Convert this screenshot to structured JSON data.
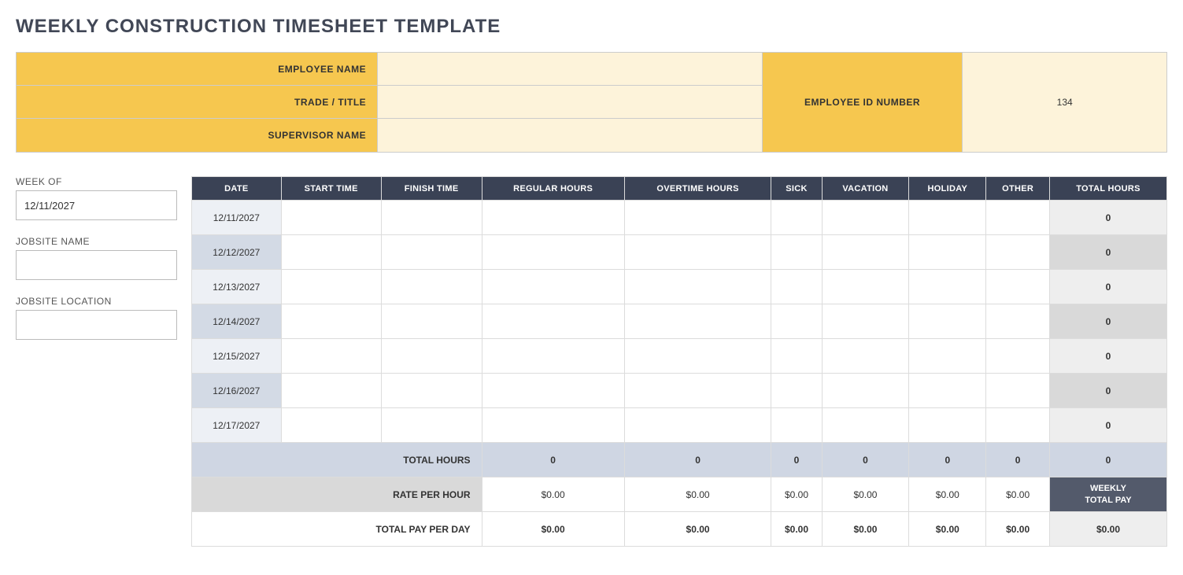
{
  "title": "WEEKLY CONSTRUCTION TIMESHEET TEMPLATE",
  "header": {
    "employee_name_label": "EMPLOYEE NAME",
    "employee_name_value": "",
    "trade_title_label": "TRADE / TITLE",
    "trade_title_value": "",
    "supervisor_name_label": "SUPERVISOR NAME",
    "supervisor_name_value": "",
    "employee_id_label": "EMPLOYEE ID NUMBER",
    "employee_id_value": "134"
  },
  "sidebar": {
    "week_of_label": "WEEK OF",
    "week_of_value": "12/11/2027",
    "jobsite_name_label": "JOBSITE NAME",
    "jobsite_name_value": "",
    "jobsite_location_label": "JOBSITE LOCATION",
    "jobsite_location_value": ""
  },
  "columns": {
    "c0": "DATE",
    "c1": "START TIME",
    "c2": "FINISH TIME",
    "c3": "REGULAR HOURS",
    "c4": "OVERTIME HOURS",
    "c5": "SICK",
    "c6": "VACATION",
    "c7": "HOLIDAY",
    "c8": "OTHER",
    "c9": "TOTAL HOURS"
  },
  "rows": [
    {
      "date": "12/11/2027",
      "start": "",
      "finish": "",
      "regular": "",
      "overtime": "",
      "sick": "",
      "vacation": "",
      "holiday": "",
      "other": "",
      "total": "0"
    },
    {
      "date": "12/12/2027",
      "start": "",
      "finish": "",
      "regular": "",
      "overtime": "",
      "sick": "",
      "vacation": "",
      "holiday": "",
      "other": "",
      "total": "0"
    },
    {
      "date": "12/13/2027",
      "start": "",
      "finish": "",
      "regular": "",
      "overtime": "",
      "sick": "",
      "vacation": "",
      "holiday": "",
      "other": "",
      "total": "0"
    },
    {
      "date": "12/14/2027",
      "start": "",
      "finish": "",
      "regular": "",
      "overtime": "",
      "sick": "",
      "vacation": "",
      "holiday": "",
      "other": "",
      "total": "0"
    },
    {
      "date": "12/15/2027",
      "start": "",
      "finish": "",
      "regular": "",
      "overtime": "",
      "sick": "",
      "vacation": "",
      "holiday": "",
      "other": "",
      "total": "0"
    },
    {
      "date": "12/16/2027",
      "start": "",
      "finish": "",
      "regular": "",
      "overtime": "",
      "sick": "",
      "vacation": "",
      "holiday": "",
      "other": "",
      "total": "0"
    },
    {
      "date": "12/17/2027",
      "start": "",
      "finish": "",
      "regular": "",
      "overtime": "",
      "sick": "",
      "vacation": "",
      "holiday": "",
      "other": "",
      "total": "0"
    }
  ],
  "summary": {
    "total_hours_label": "TOTAL HOURS",
    "total_hours": {
      "regular": "0",
      "overtime": "0",
      "sick": "0",
      "vacation": "0",
      "holiday": "0",
      "other": "0",
      "grand": "0"
    },
    "rate_label": "RATE PER HOUR",
    "rate": {
      "regular": "$0.00",
      "overtime": "$0.00",
      "sick": "$0.00",
      "vacation": "$0.00",
      "holiday": "$0.00",
      "other": "$0.00"
    },
    "weekly_total_pay_label": "WEEKLY\nTOTAL PAY",
    "total_pay_label": "TOTAL PAY PER DAY",
    "total_pay": {
      "regular": "$0.00",
      "overtime": "$0.00",
      "sick": "$0.00",
      "vacation": "$0.00",
      "holiday": "$0.00",
      "other": "$0.00",
      "grand": "$0.00"
    }
  }
}
